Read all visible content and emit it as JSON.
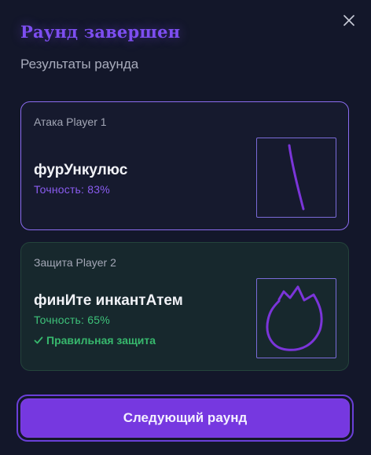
{
  "modal": {
    "title": "Раунд завершен",
    "subtitle": "Результаты раунда"
  },
  "attack": {
    "label": "Атака Player 1",
    "spell_name": "фурУнкулюс",
    "accuracy": "Точность: 83%"
  },
  "defense": {
    "label": "Защита Player 2",
    "spell_name": "финИте инкантАтем",
    "accuracy": "Точность: 65%",
    "verdict": "Правильная защита"
  },
  "actions": {
    "next_round_label": "Следующий раунд"
  },
  "colors": {
    "accent": "#7638e0",
    "title": "#7d4ef0",
    "attack_accuracy": "#8a5cf0",
    "defense_accuracy": "#3ec27a",
    "verdict": "#37b86d",
    "stroke": "#7b35d9"
  },
  "icons": {
    "close": "close-icon",
    "check": "check-icon"
  }
}
